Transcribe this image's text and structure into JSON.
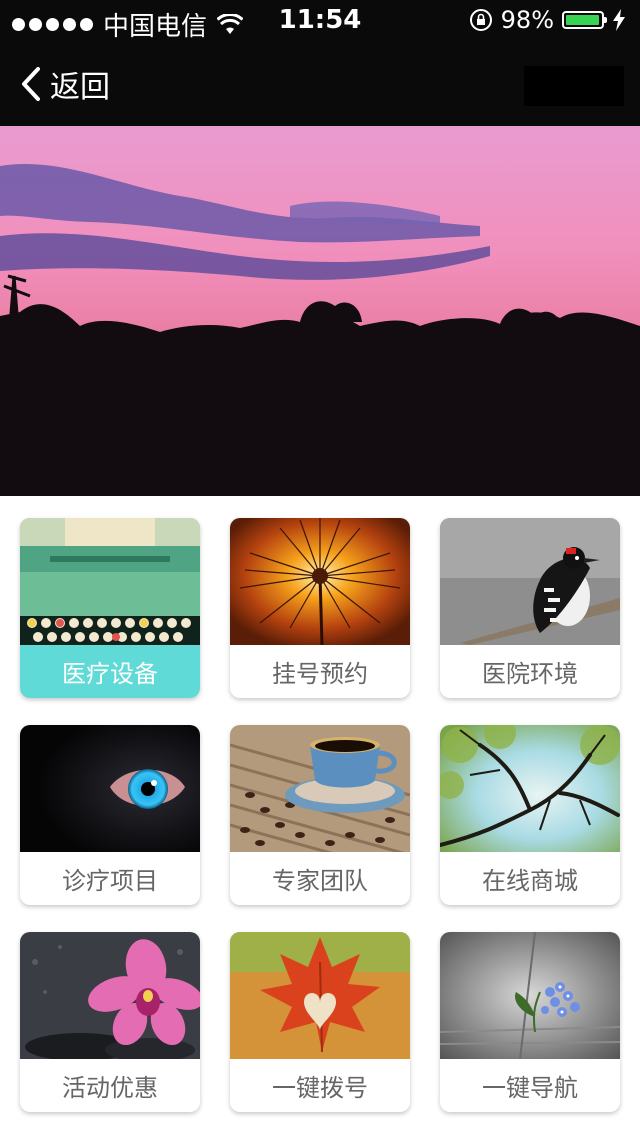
{
  "status_bar": {
    "carrier": "中国电信",
    "time": "11:54",
    "battery": "98%",
    "battery_level": 0.98
  },
  "nav": {
    "back_label": "返回"
  },
  "grid": {
    "items": [
      {
        "label": "医疗设备",
        "icon": "typewriter",
        "active": true
      },
      {
        "label": "挂号预约",
        "icon": "dandelion",
        "active": false
      },
      {
        "label": "医院环境",
        "icon": "woodpecker",
        "active": false
      },
      {
        "label": "诊疗项目",
        "icon": "eye",
        "active": false
      },
      {
        "label": "专家团队",
        "icon": "coffee-cup",
        "active": false
      },
      {
        "label": "在线商城",
        "icon": "tree-branches",
        "active": false
      },
      {
        "label": "活动优惠",
        "icon": "orchid",
        "active": false
      },
      {
        "label": "一键拨号",
        "icon": "maple-leaf",
        "active": false
      },
      {
        "label": "一键导航",
        "icon": "blue-flower",
        "active": false
      }
    ]
  },
  "colors": {
    "active_label_bg": "#5fdad7",
    "nav_bg": "#0a0a0a",
    "battery_fill": "#39d353"
  }
}
